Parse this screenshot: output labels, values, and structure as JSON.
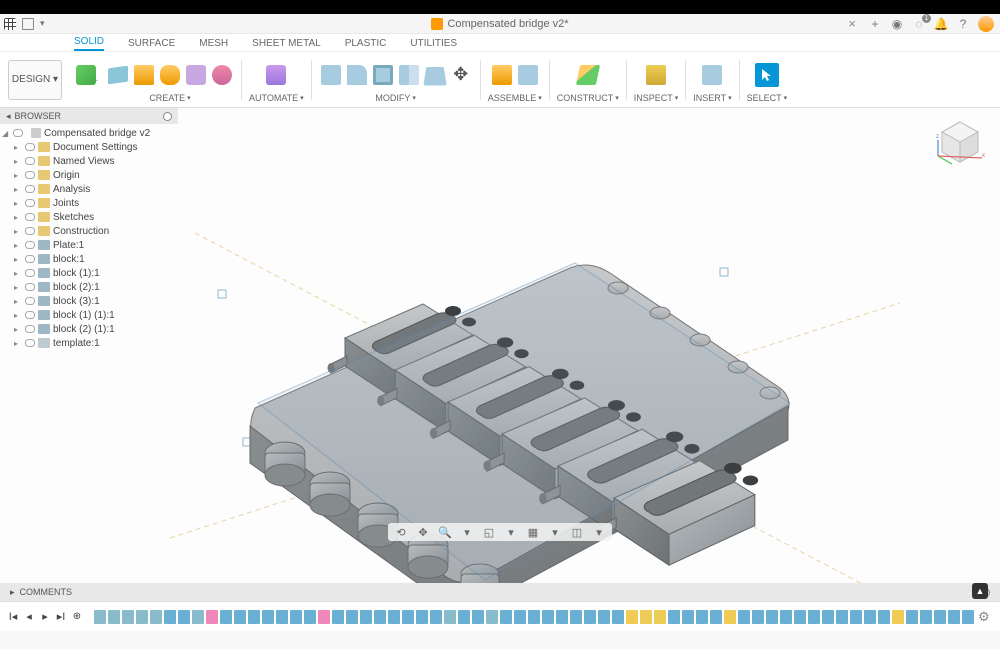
{
  "titlebar": {
    "document_name": "Compensated bridge v2*",
    "close_label": "×",
    "notif_count": "1"
  },
  "ribbon_tabs": [
    "SOLID",
    "SURFACE",
    "MESH",
    "SHEET METAL",
    "PLASTIC",
    "UTILITIES"
  ],
  "active_tab_index": 0,
  "design_button": "DESIGN ▾",
  "ribbon_groups": {
    "create": "CREATE",
    "automate": "AUTOMATE",
    "modify": "MODIFY",
    "assemble": "ASSEMBLE",
    "construct": "CONSTRUCT",
    "inspect": "INSPECT",
    "insert": "INSERT",
    "select": "SELECT"
  },
  "browser": {
    "title": "BROWSER",
    "root": "Compensated bridge v2",
    "items": [
      {
        "name": "Document Settings",
        "icon": "folder",
        "indent": 1,
        "toggle": "▸"
      },
      {
        "name": "Named Views",
        "icon": "folder",
        "indent": 1,
        "toggle": "▸"
      },
      {
        "name": "Origin",
        "icon": "folder",
        "indent": 1,
        "toggle": "▸"
      },
      {
        "name": "Analysis",
        "icon": "folder",
        "indent": 1,
        "toggle": "▸"
      },
      {
        "name": "Joints",
        "icon": "folder",
        "indent": 1,
        "toggle": "▸"
      },
      {
        "name": "Sketches",
        "icon": "folder",
        "indent": 1,
        "toggle": "▸"
      },
      {
        "name": "Construction",
        "icon": "folder",
        "indent": 1,
        "toggle": "▸"
      },
      {
        "name": "Plate:1",
        "icon": "comp",
        "indent": 1,
        "toggle": "▸"
      },
      {
        "name": "block:1",
        "icon": "comp",
        "indent": 1,
        "toggle": "▸"
      },
      {
        "name": "block (1):1",
        "icon": "comp",
        "indent": 1,
        "toggle": "▸"
      },
      {
        "name": "block (2):1",
        "icon": "comp",
        "indent": 1,
        "toggle": "▸"
      },
      {
        "name": "block (3):1",
        "icon": "comp",
        "indent": 1,
        "toggle": "▸"
      },
      {
        "name": "block (1) (1):1",
        "icon": "comp",
        "indent": 1,
        "toggle": "▸"
      },
      {
        "name": "block (2) (1):1",
        "icon": "comp",
        "indent": 1,
        "toggle": "▸"
      },
      {
        "name": "template:1",
        "icon": "body",
        "indent": 1,
        "toggle": "▸"
      }
    ]
  },
  "comments": {
    "label": "COMMENTS"
  },
  "timeline_colors": [
    "#8bc",
    "#8bc",
    "#8bc",
    "#8bc",
    "#8bc",
    "#6ab0d4",
    "#6ab0d4",
    "#8bc",
    "#e8b",
    "#6ab0d4",
    "#6ab0d4",
    "#6ab0d4",
    "#6ab0d4",
    "#6ab0d4",
    "#6ab0d4",
    "#6ab0d4",
    "#e8b",
    "#6ab0d4",
    "#6ab0d4",
    "#6ab0d4",
    "#6ab0d4",
    "#6ab0d4",
    "#6ab0d4",
    "#6ab0d4",
    "#6ab0d4",
    "#8bc",
    "#6ab0d4",
    "#6ab0d4",
    "#8bc",
    "#6ab0d4",
    "#6ab0d4",
    "#6ab0d4",
    "#6ab0d4",
    "#6ab0d4",
    "#6ab0d4",
    "#6ab0d4",
    "#6ab0d4",
    "#6ab0d4",
    "#ec5",
    "#ec5",
    "#ec5",
    "#6ab0d4",
    "#6ab0d4",
    "#6ab0d4",
    "#6ab0d4",
    "#ec5",
    "#6ab0d4",
    "#6ab0d4",
    "#6ab0d4",
    "#6ab0d4",
    "#6ab0d4",
    "#6ab0d4",
    "#6ab0d4",
    "#6ab0d4",
    "#6ab0d4",
    "#6ab0d4",
    "#6ab0d4",
    "#ec5",
    "#6ab0d4",
    "#6ab0d4",
    "#6ab0d4",
    "#6ab0d4",
    "#6ab0d4",
    "#6ab0d4",
    "#6ab0d4"
  ],
  "viewcube_labels": {
    "front": "",
    "top": "",
    "right": ""
  }
}
